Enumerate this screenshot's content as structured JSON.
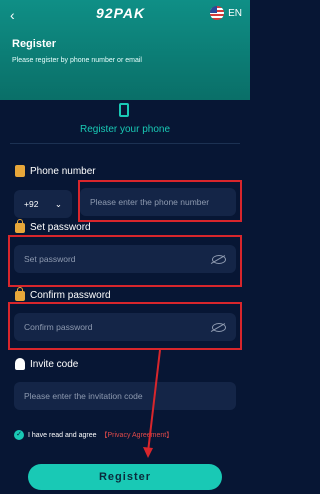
{
  "header": {
    "back_icon": "‹",
    "logo_text": "92PAK",
    "language": "EN",
    "title": "Register",
    "subtitle": "Please register by phone number or email"
  },
  "tab": {
    "label": "Register your phone"
  },
  "phone": {
    "label": "Phone number",
    "country_code": "+92",
    "placeholder": "Please enter the phone number"
  },
  "password": {
    "label": "Set password",
    "placeholder": "Set password"
  },
  "confirm": {
    "label": "Confirm password",
    "placeholder": "Confirm password"
  },
  "invite": {
    "label": "Invite code",
    "placeholder": "Please enter the invitation code"
  },
  "agreement": {
    "text": "I have read and agree",
    "link": "【Privacy Agreement】"
  },
  "submit": {
    "label": "Register"
  },
  "colors": {
    "accent": "#19c9b5",
    "background": "#071634",
    "annotation": "#d8262c"
  }
}
